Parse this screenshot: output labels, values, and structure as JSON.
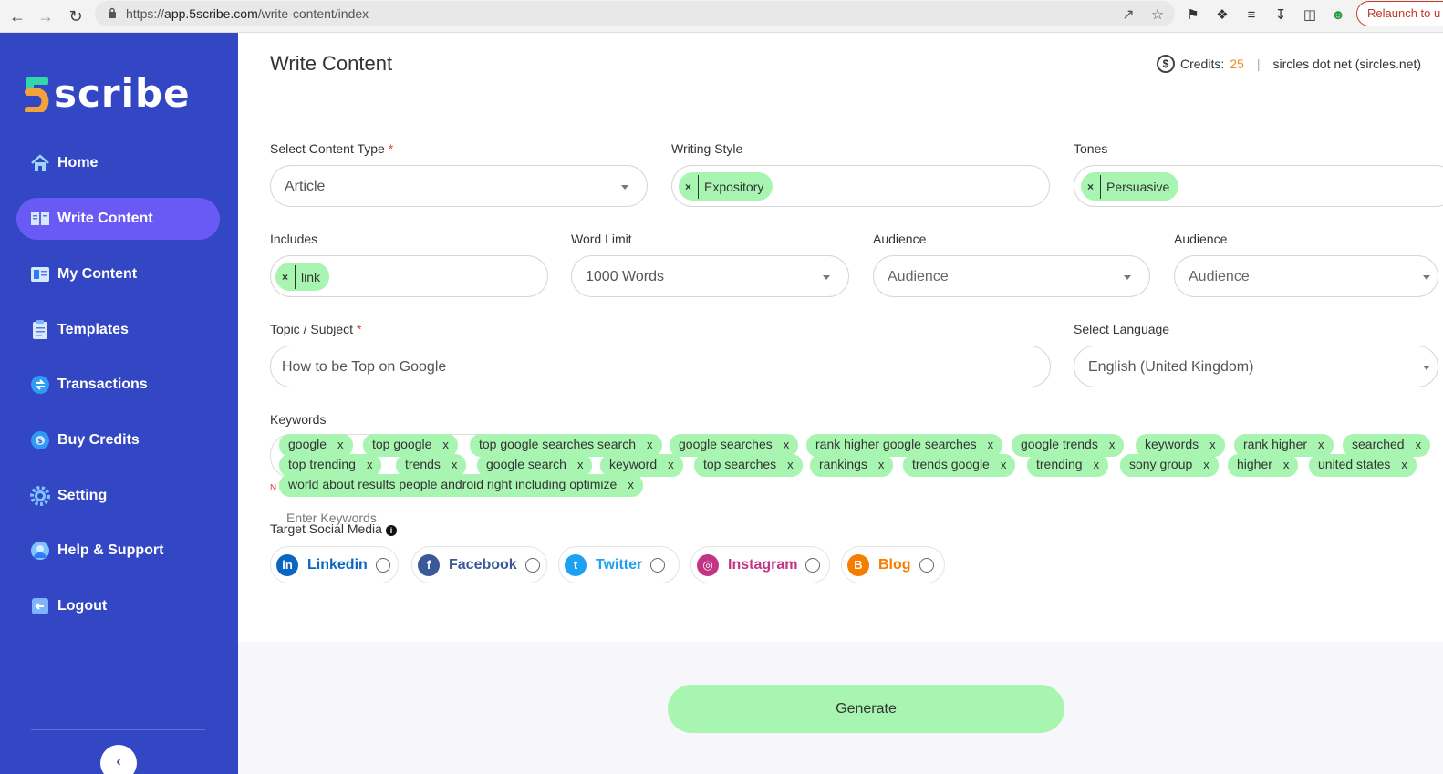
{
  "browser": {
    "url_scheme": "https://",
    "url_host": "app.5scribe.com",
    "url_path": "/write-content/index",
    "relaunch_label": "Relaunch to u"
  },
  "sidebar": {
    "logo_text": "scribe",
    "logo_digit": "5",
    "items": [
      {
        "label": "Home",
        "icon": "home-icon"
      },
      {
        "label": "Write Content",
        "icon": "write-content-icon",
        "active": true
      },
      {
        "label": "My Content",
        "icon": "my-content-icon"
      },
      {
        "label": "Templates",
        "icon": "templates-icon"
      },
      {
        "label": "Transactions",
        "icon": "transactions-icon"
      },
      {
        "label": "Buy Credits",
        "icon": "buy-credits-icon"
      },
      {
        "label": "Setting",
        "icon": "gear-icon"
      },
      {
        "label": "Help & Support",
        "icon": "help-icon"
      },
      {
        "label": "Logout",
        "icon": "logout-icon"
      }
    ],
    "collapse_glyph": "‹"
  },
  "header": {
    "title": "Write Content",
    "credits_label": "Credits:",
    "credits_value": "25",
    "separator": "|",
    "account": "sircles dot net (sircles.net)"
  },
  "form": {
    "content_type": {
      "label": "Select Content Type",
      "required": "*",
      "value": "Article"
    },
    "writing_style": {
      "label": "Writing Style",
      "chip": "Expository"
    },
    "tones": {
      "label": "Tones",
      "chip": "Persuasive"
    },
    "includes": {
      "label": "Includes",
      "chip": "link"
    },
    "word_limit": {
      "label": "Word Limit",
      "value": "1000 Words"
    },
    "audience1": {
      "label": "Audience",
      "placeholder": "Audience"
    },
    "audience2": {
      "label": "Audience",
      "placeholder": "Audience"
    },
    "topic": {
      "label": "Topic / Subject",
      "required": "*",
      "value": "How to be Top on Google"
    },
    "language": {
      "label": "Select Language",
      "value": "English (United Kingdom)"
    },
    "keywords": {
      "label": "Keywords",
      "chip_remove": "x",
      "items": [
        "google",
        "top google",
        "top google searches search",
        "google searches",
        "rank higher google searches",
        "google trends",
        "keywords",
        "rank higher",
        "searched",
        "top trending",
        "trends",
        "google search",
        "keyword",
        "top searches",
        "rankings",
        "trends google",
        "trending",
        "sony group",
        "higher",
        "united states",
        "world about results people android right including optimize"
      ],
      "input_placeholder": "Enter Keywords",
      "note_fragment": "N"
    },
    "social": {
      "label": "Target Social Media",
      "info_glyph": "i",
      "options": [
        {
          "label": "Linkedin",
          "icon": "linkedin-icon",
          "glyph": "in",
          "color": "#0a66c2"
        },
        {
          "label": "Facebook",
          "icon": "facebook-icon",
          "glyph": "f",
          "color": "#3b5998"
        },
        {
          "label": "Twitter",
          "icon": "twitter-icon",
          "glyph": "t",
          "color": "#1da1f2"
        },
        {
          "label": "Instagram",
          "icon": "instagram-icon",
          "glyph": "◎",
          "color": "#c13584"
        },
        {
          "label": "Blog",
          "icon": "blogger-icon",
          "glyph": "B",
          "color": "#f57d00"
        }
      ]
    },
    "generate_label": "Generate"
  },
  "colors": {
    "sidebar": "#3346c4",
    "active_nav": "#6a5af5",
    "chip": "#a7f5b0",
    "credits": "#f08a24",
    "required": "#e53935"
  }
}
